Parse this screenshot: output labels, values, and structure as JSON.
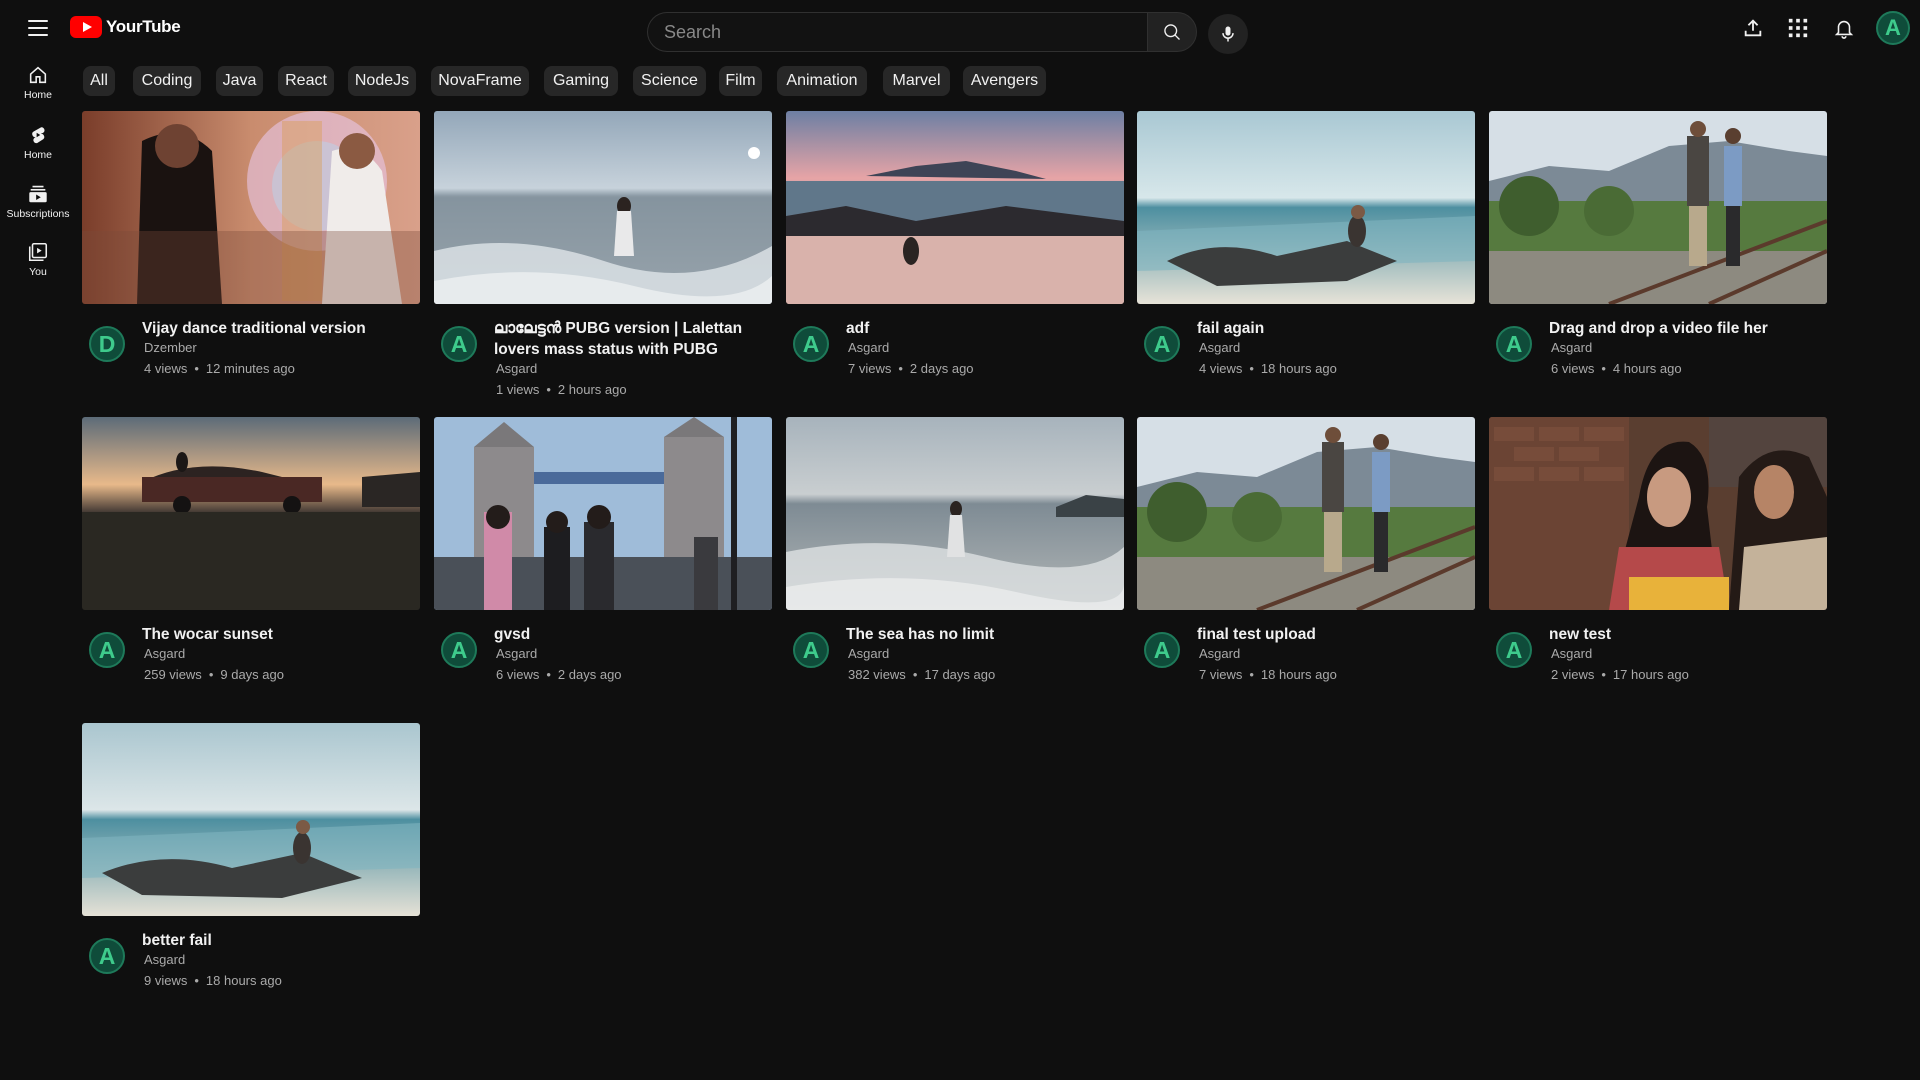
{
  "app": {
    "logo_text": "YourTube"
  },
  "search": {
    "placeholder": "Search"
  },
  "sidebar": {
    "items": [
      {
        "label": "Home",
        "icon": "home-icon"
      },
      {
        "label": "Home",
        "icon": "shorts-icon"
      },
      {
        "label": "Subscriptions",
        "icon": "subscriptions-icon"
      },
      {
        "label": "You",
        "icon": "you-icon"
      }
    ]
  },
  "user": {
    "avatar_letter": "A"
  },
  "chips": [
    "All",
    "Coding",
    "Java",
    "React",
    "NodeJs",
    "NovaFrame",
    "Gaming",
    "Science",
    "Film",
    "Animation",
    "Marvel",
    "Avengers"
  ],
  "videos": [
    {
      "title": "Vijay dance traditional version",
      "channel": "Dzember",
      "avatar": "D",
      "views": "4 views",
      "time": "12 minutes ago"
    },
    {
      "title": "ലാലേട്ടൻ PUBG version | Lalettan lovers mass status with PUBG",
      "channel": "Asgard",
      "avatar": "A",
      "views": "1 views",
      "time": "2 hours ago"
    },
    {
      "title": "adf",
      "channel": "Asgard",
      "avatar": "A",
      "views": "7 views",
      "time": "2 days ago"
    },
    {
      "title": "fail again",
      "channel": "Asgard",
      "avatar": "A",
      "views": "4 views",
      "time": "18 hours ago"
    },
    {
      "title": "Drag and drop a video file her",
      "channel": "Asgard",
      "avatar": "A",
      "views": "6 views",
      "time": "4 hours ago"
    },
    {
      "title": "The wocar sunset",
      "channel": "Asgard",
      "avatar": "A",
      "views": "259 views",
      "time": "9 days ago"
    },
    {
      "title": "gvsd",
      "channel": "Asgard",
      "avatar": "A",
      "views": "6 views",
      "time": "2 days ago"
    },
    {
      "title": "The sea has no limit",
      "channel": "Asgard",
      "avatar": "A",
      "views": "382 views",
      "time": "17 days ago"
    },
    {
      "title": "final test upload",
      "channel": "Asgard",
      "avatar": "A",
      "views": "7 views",
      "time": "18 hours ago"
    },
    {
      "title": "new test",
      "channel": "Asgard",
      "avatar": "A",
      "views": "2 views",
      "time": "17 hours ago"
    },
    {
      "title": "better fail",
      "channel": "Asgard",
      "avatar": "A",
      "views": "9 views",
      "time": "18 hours ago"
    }
  ]
}
